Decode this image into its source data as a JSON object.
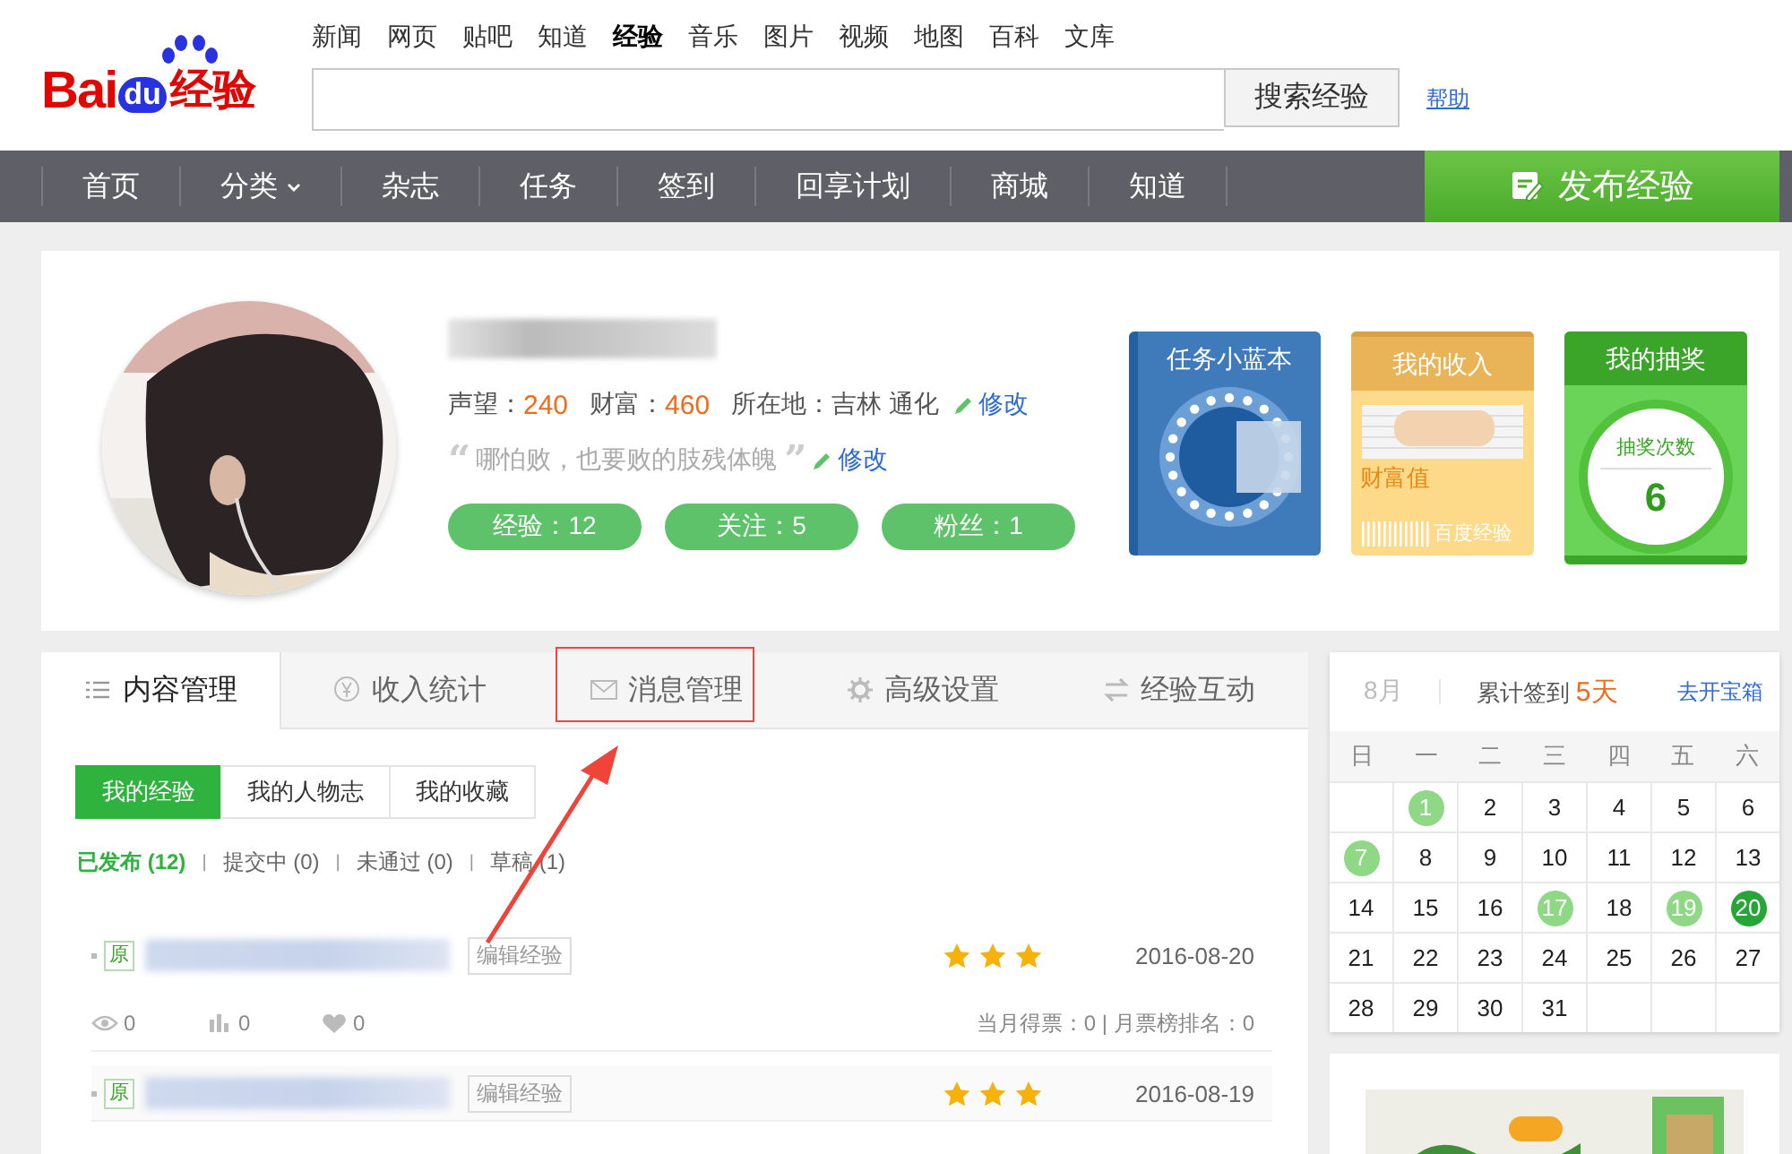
{
  "header": {
    "logo": {
      "bai": "Bai",
      "du": "du",
      "suffix": "经验"
    },
    "links": [
      {
        "label": "新闻",
        "selected": false
      },
      {
        "label": "网页",
        "selected": false
      },
      {
        "label": "贴吧",
        "selected": false
      },
      {
        "label": "知道",
        "selected": false
      },
      {
        "label": "经验",
        "selected": true
      },
      {
        "label": "音乐",
        "selected": false
      },
      {
        "label": "图片",
        "selected": false
      },
      {
        "label": "视频",
        "selected": false
      },
      {
        "label": "地图",
        "selected": false
      },
      {
        "label": "百科",
        "selected": false
      },
      {
        "label": "文库",
        "selected": false
      }
    ],
    "search_button": "搜索经验",
    "help": "帮助"
  },
  "nav": {
    "items": [
      {
        "label": "首页",
        "dropdown": false
      },
      {
        "label": "分类",
        "dropdown": true
      },
      {
        "label": "杂志",
        "dropdown": false
      },
      {
        "label": "任务",
        "dropdown": false
      },
      {
        "label": "签到",
        "dropdown": false
      },
      {
        "label": "回享计划",
        "dropdown": false
      },
      {
        "label": "商城",
        "dropdown": false
      },
      {
        "label": "知道",
        "dropdown": false
      }
    ],
    "publish": "发布经验"
  },
  "profile": {
    "stats": [
      {
        "label": "声望：",
        "value": "240"
      },
      {
        "label": "财富：",
        "value": "460"
      }
    ],
    "location_label": "所在地：",
    "location": "吉林 通化",
    "edit": "修改",
    "open_quote": "“",
    "motto": "哪怕败，也要败的肢残体魄",
    "close_quote": "”",
    "motto_edit": "修改",
    "badges": [
      "经验：12",
      "关注：5",
      "粉丝：1"
    ],
    "cards": [
      {
        "kind": "task",
        "title": "任务小蓝本"
      },
      {
        "kind": "income",
        "title": "我的收入",
        "caption": "财富值",
        "footer": "百度经验"
      },
      {
        "kind": "lottery",
        "title": "我的抽奖",
        "label": "抽奖次数",
        "count": "6"
      }
    ]
  },
  "content": {
    "tabs": [
      {
        "label": "内容管理",
        "kind": "list",
        "selected": true
      },
      {
        "label": "收入统计",
        "kind": "yen",
        "selected": false
      },
      {
        "label": "消息管理",
        "kind": "mail",
        "selected": false
      },
      {
        "label": "高级设置",
        "kind": "gear",
        "selected": false
      },
      {
        "label": "经验互动",
        "kind": "swap",
        "selected": false
      }
    ],
    "subtabs": [
      {
        "label": "我的经验",
        "selected": true
      },
      {
        "label": "我的人物志",
        "selected": false
      },
      {
        "label": "我的收藏",
        "selected": false
      }
    ],
    "filters": [
      {
        "label": "已发布 (12)",
        "selected": true
      },
      {
        "separator": "|",
        "label": "提交中 (0)",
        "selected": false
      },
      {
        "separator": "|",
        "label": "未通过 (0)",
        "selected": false
      },
      {
        "separator": "|",
        "label": "草稿 (1)",
        "selected": false
      }
    ],
    "articles": [
      {
        "tag": "原",
        "edit": "编辑经验",
        "stars": 3,
        "date": "2016-08-20",
        "views": "0",
        "votes": "0",
        "likes": "0",
        "monthly": "当月得票：0 | 月票榜排名：0"
      },
      {
        "tag": "原",
        "edit": "编辑经验",
        "stars": 3,
        "date": "2016-08-19"
      }
    ]
  },
  "calendar": {
    "month": "8月",
    "total_label": "累计签到",
    "total": "5天",
    "chest": "去开宝箱",
    "weekdays": [
      "日",
      "一",
      "二",
      "三",
      "四",
      "五",
      "六"
    ],
    "weeks": [
      [
        {
          "kind": "blank"
        },
        {
          "day": "1",
          "kind": "signed"
        },
        {
          "day": "2",
          "kind": "plain"
        },
        {
          "day": "3",
          "kind": "plain"
        },
        {
          "day": "4",
          "kind": "plain"
        },
        {
          "day": "5",
          "kind": "plain"
        },
        {
          "day": "6",
          "kind": "plain"
        }
      ],
      [
        {
          "day": "7",
          "kind": "signed"
        },
        {
          "day": "8",
          "kind": "plain"
        },
        {
          "day": "9",
          "kind": "plain"
        },
        {
          "day": "10",
          "kind": "plain"
        },
        {
          "day": "11",
          "kind": "plain"
        },
        {
          "day": "12",
          "kind": "plain"
        },
        {
          "day": "13",
          "kind": "plain"
        }
      ],
      [
        {
          "day": "14",
          "kind": "plain"
        },
        {
          "day": "15",
          "kind": "plain"
        },
        {
          "day": "16",
          "kind": "plain"
        },
        {
          "day": "17",
          "kind": "signed"
        },
        {
          "day": "18",
          "kind": "plain"
        },
        {
          "day": "19",
          "kind": "signed"
        },
        {
          "day": "20",
          "kind": "today"
        }
      ],
      [
        {
          "day": "21",
          "kind": "plain"
        },
        {
          "day": "22",
          "kind": "plain"
        },
        {
          "day": "23",
          "kind": "plain"
        },
        {
          "day": "24",
          "kind": "plain"
        },
        {
          "day": "25",
          "kind": "plain"
        },
        {
          "day": "26",
          "kind": "plain"
        },
        {
          "day": "27",
          "kind": "plain"
        }
      ],
      [
        {
          "day": "28",
          "kind": "plain"
        },
        {
          "day": "29",
          "kind": "plain"
        },
        {
          "day": "30",
          "kind": "plain"
        },
        {
          "day": "31",
          "kind": "plain"
        },
        {
          "kind": "blank"
        },
        {
          "kind": "blank"
        },
        {
          "kind": "blank"
        }
      ]
    ]
  }
}
